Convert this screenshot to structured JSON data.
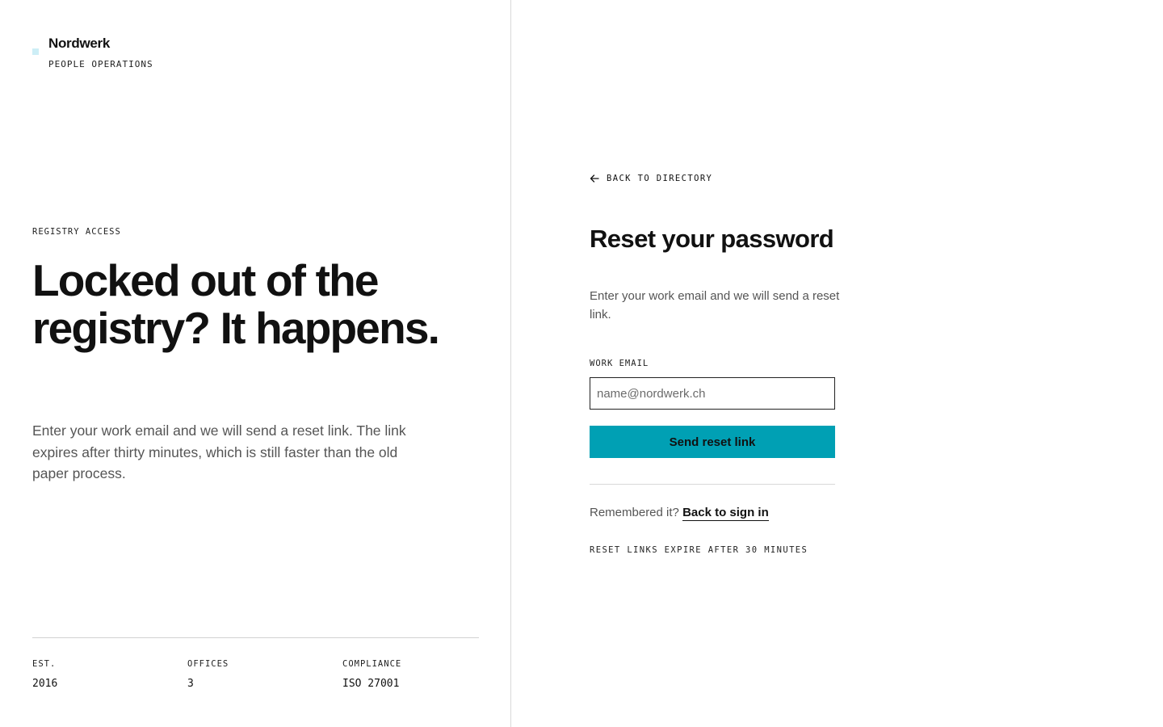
{
  "brand": {
    "name": "Nordwerk",
    "subtitle": "PEOPLE OPERATIONS",
    "mark_color": "#cdeef6"
  },
  "hero": {
    "eyebrow": "REGISTRY ACCESS",
    "title": "Locked out of the registry? It happens.",
    "description": "Enter your work email and we will send a reset link. The link expires after thirty minutes, which is still faster than the old paper process."
  },
  "stats": [
    {
      "label": "EST.",
      "value": "2016"
    },
    {
      "label": "OFFICES",
      "value": "3"
    },
    {
      "label": "COMPLIANCE",
      "value": "ISO 27001"
    }
  ],
  "form": {
    "back_link": "BACK TO DIRECTORY",
    "back_icon": "arrow-left-icon",
    "title": "Reset your password",
    "description": "Enter your work email and we will send a reset link.",
    "email_label": "WORK EMAIL",
    "email_placeholder": "name@nordwerk.ch",
    "email_value": "",
    "submit_label": "Send reset link",
    "remember_text": "Remembered it?",
    "sign_in_link": "Back to sign in",
    "expiry_note": "RESET LINKS EXPIRE AFTER 30 MINUTES"
  },
  "colors": {
    "accent": "#00a0b4",
    "text": "#111111",
    "muted": "#555555",
    "border": "#d9d9d9"
  }
}
